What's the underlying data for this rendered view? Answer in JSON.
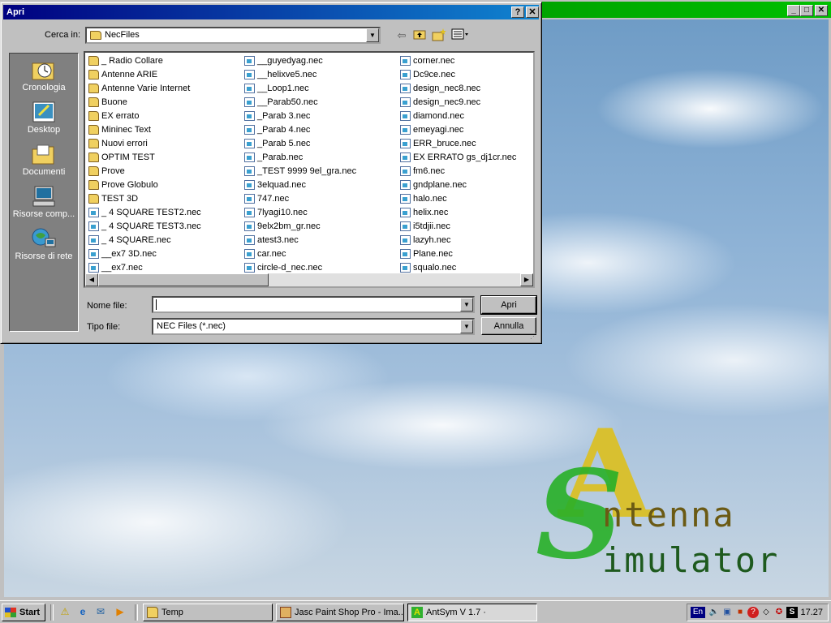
{
  "dialog": {
    "title": "Apri",
    "help_glyph": "?",
    "close_glyph": "✕",
    "look_in_label": "Cerca in:",
    "look_in_value": "NecFiles",
    "filename_label": "Nome file:",
    "filename_value": "",
    "filetype_label": "Tipo file:",
    "filetype_value": "NEC Files (*.nec)",
    "open_label": "Apri",
    "cancel_label": "Annulla",
    "places": [
      {
        "label": "Cronologia",
        "icon": "history-icon"
      },
      {
        "label": "Desktop",
        "icon": "desktop-icon"
      },
      {
        "label": "Documenti",
        "icon": "documents-folder-icon"
      },
      {
        "label": "Risorse comp...",
        "icon": "my-computer-icon"
      },
      {
        "label": "Risorse di rete",
        "icon": "network-icon"
      }
    ],
    "columns": [
      [
        {
          "name": "_ Radio Collare",
          "type": "folder"
        },
        {
          "name": "Antenne ARIE",
          "type": "folder"
        },
        {
          "name": "Antenne Varie Internet",
          "type": "folder"
        },
        {
          "name": "Buone",
          "type": "folder"
        },
        {
          "name": "EX errato",
          "type": "folder"
        },
        {
          "name": "Mininec Text",
          "type": "folder"
        },
        {
          "name": "Nuovi errori",
          "type": "folder"
        },
        {
          "name": "OPTIM TEST",
          "type": "folder"
        },
        {
          "name": "Prove",
          "type": "folder"
        },
        {
          "name": "Prove Globulo",
          "type": "folder"
        },
        {
          "name": "TEST 3D",
          "type": "folder"
        },
        {
          "name": "_ 4 SQUARE TEST2.nec",
          "type": "file"
        },
        {
          "name": "_ 4 SQUARE TEST3.nec",
          "type": "file"
        },
        {
          "name": "_ 4 SQUARE.nec",
          "type": "file"
        },
        {
          "name": "__ex7 3D.nec",
          "type": "file"
        },
        {
          "name": "__ex7.nec",
          "type": "file"
        }
      ],
      [
        {
          "name": "__guyedyag.nec",
          "type": "file"
        },
        {
          "name": "__helixve5.nec",
          "type": "file"
        },
        {
          "name": "__Loop1.nec",
          "type": "file"
        },
        {
          "name": "__Parab50.nec",
          "type": "file"
        },
        {
          "name": "_Parab 3.nec",
          "type": "file"
        },
        {
          "name": "_Parab 4.nec",
          "type": "file"
        },
        {
          "name": "_Parab 5.nec",
          "type": "file"
        },
        {
          "name": "_Parab.nec",
          "type": "file"
        },
        {
          "name": "_TEST 9999 9el_gra.nec",
          "type": "file"
        },
        {
          "name": "3elquad.nec",
          "type": "file"
        },
        {
          "name": "747.nec",
          "type": "file"
        },
        {
          "name": "7lyagi10.nec",
          "type": "file"
        },
        {
          "name": "9elx2bm_gr.nec",
          "type": "file"
        },
        {
          "name": "atest3.nec",
          "type": "file"
        },
        {
          "name": "car.nec",
          "type": "file"
        },
        {
          "name": "circle-d_nec.nec",
          "type": "file"
        }
      ],
      [
        {
          "name": "corner.nec",
          "type": "file"
        },
        {
          "name": "Dc9ce.nec",
          "type": "file"
        },
        {
          "name": "design_nec8.nec",
          "type": "file"
        },
        {
          "name": "design_nec9.nec",
          "type": "file"
        },
        {
          "name": "diamond.nec",
          "type": "file"
        },
        {
          "name": "emeyagi.nec",
          "type": "file"
        },
        {
          "name": "ERR_bruce.nec",
          "type": "file"
        },
        {
          "name": "EX ERRATO gs_dj1cr.nec",
          "type": "file"
        },
        {
          "name": "fm6.nec",
          "type": "file"
        },
        {
          "name": "gndplane.nec",
          "type": "file"
        },
        {
          "name": "halo.nec",
          "type": "file"
        },
        {
          "name": "helix.nec",
          "type": "file"
        },
        {
          "name": "i5tdjii.nec",
          "type": "file"
        },
        {
          "name": "lazyh.nec",
          "type": "file"
        },
        {
          "name": "Plane.nec",
          "type": "file"
        },
        {
          "name": "squalo.nec",
          "type": "file"
        }
      ]
    ]
  },
  "app": {
    "logo_line1": "ntenna",
    "logo_line2": "imulator",
    "logo_A": "A",
    "logo_S": "S"
  },
  "taskbar": {
    "start_label": "Start",
    "tasks": [
      {
        "label": "Temp"
      },
      {
        "label": "Jasc Paint Shop Pro - Ima..."
      },
      {
        "label": "AntSym   V 1.7     ·"
      }
    ],
    "language": "En",
    "clock": "17.27"
  },
  "colors": {
    "titlebar_active": "#000080",
    "app_titlebar": "#008000",
    "face": "#c0c0c0"
  }
}
